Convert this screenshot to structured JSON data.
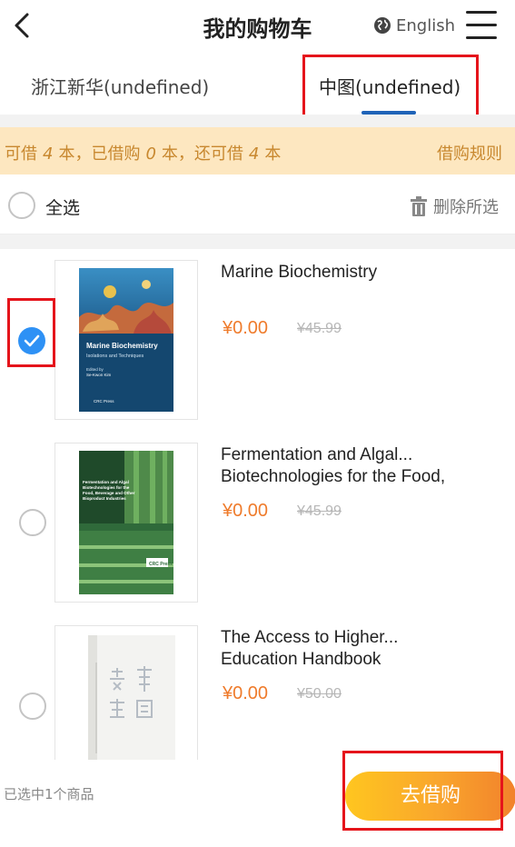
{
  "header": {
    "title": "我的购物车",
    "language": "English"
  },
  "tabs": [
    {
      "label": "浙江新华(undefined)",
      "active": false
    },
    {
      "label": "中图(undefined)",
      "active": true
    }
  ],
  "notice": {
    "text_part1": "可借",
    "borrowable_total": "4",
    "text_part2": "本，已借购",
    "borrowed": "0",
    "text_part3": "本，还可借",
    "remaining": "4",
    "text_part4": "本",
    "rules_link": "借购规则"
  },
  "select_all": {
    "label": "全选",
    "delete_label": "删除所选"
  },
  "items": [
    {
      "title": "Marine Biochemistry",
      "price": "¥0.00",
      "original_price": "¥45.99",
      "checked": true,
      "cover_title": "Marine Biochemistry",
      "cover_subtitle": "Isolations and Techniques",
      "cover_editor_label": "Edited by",
      "cover_editor": "Se-Kwon Kim",
      "cover_publisher": "CRC Press"
    },
    {
      "title": "Fermentation and Algal...",
      "title_line2": "Biotechnologies for the Food,",
      "price": "¥0.00",
      "original_price": "¥45.99",
      "checked": false,
      "cover_title": "Fermentation and Algal Biotechnologies for the Food, Beverage and Other Bioproduct Industries",
      "cover_publisher": "CRC Press"
    },
    {
      "title": "The Access to Higher...",
      "title_line2": "Education Handbook",
      "price": "¥0.00",
      "original_price": "¥50.00",
      "checked": false
    }
  ],
  "bottom": {
    "selected_count": "已选中1个商品",
    "go_button": "去借购"
  },
  "colors": {
    "accent_blue": "#2e91f5",
    "price_orange": "#ef7b2b",
    "notice_bg": "#fde7c0",
    "highlight_red": "#e5141b"
  }
}
